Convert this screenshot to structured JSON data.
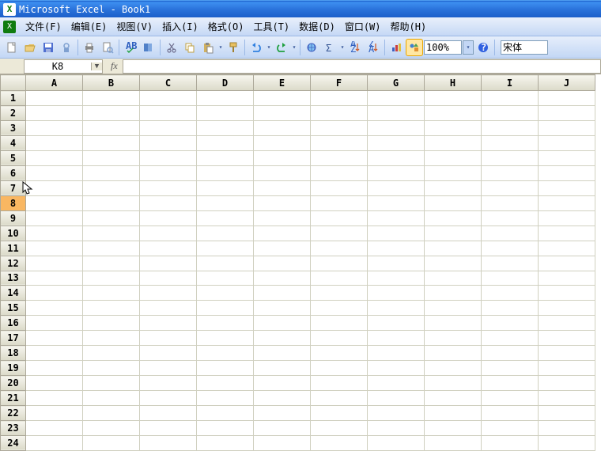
{
  "title": "Microsoft Excel - Book1",
  "menu": {
    "file": "文件(F)",
    "edit": "编辑(E)",
    "view": "视图(V)",
    "insert": "插入(I)",
    "format": "格式(O)",
    "tools": "工具(T)",
    "data": "数据(D)",
    "window": "窗口(W)",
    "help": "帮助(H)"
  },
  "toolbar": {
    "zoom": "100%",
    "font": "宋体"
  },
  "formula": {
    "active_cell": "K8",
    "fx_label": "fx",
    "content": ""
  },
  "grid": {
    "columns": [
      "A",
      "B",
      "C",
      "D",
      "E",
      "F",
      "G",
      "H",
      "I",
      "J"
    ],
    "rows": [
      "1",
      "2",
      "3",
      "4",
      "5",
      "6",
      "7",
      "8",
      "9",
      "10",
      "11",
      "12",
      "13",
      "14",
      "15",
      "16",
      "17",
      "18",
      "19",
      "20",
      "21",
      "22",
      "23",
      "24"
    ],
    "selected_row": "8"
  },
  "icons": {
    "new": "#c8a050",
    "open": "#e8c060",
    "save": "#4f6fd0",
    "perm": "#7fa0d0",
    "print": "#888",
    "preview": "#7fa0d0",
    "spell": "#3060c0",
    "research": "#5080c8",
    "cut": "#707090",
    "copy": "#e0c070",
    "paste": "#d0b060",
    "fmtpaint": "#e8c060",
    "undo": "#3080e0",
    "redo": "#20a040",
    "link": "#4060c0",
    "sum": "#305090",
    "sortasc": "#3060c0",
    "sortdesc": "#3060c0",
    "chart": "#cc4040",
    "draw": "#e09030",
    "help": "#3060e0"
  }
}
